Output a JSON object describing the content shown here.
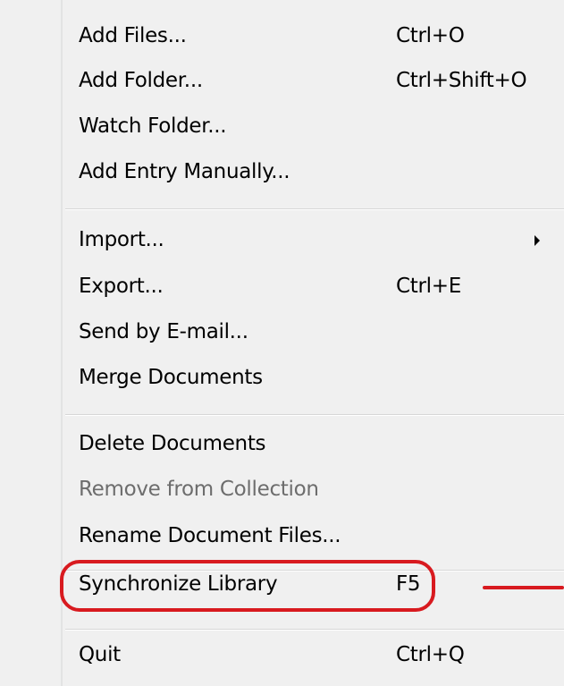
{
  "menu": {
    "items": [
      {
        "label": "Add Files...",
        "shortcut": "Ctrl+O"
      },
      {
        "label": "Add Folder...",
        "shortcut": "Ctrl+Shift+O"
      },
      {
        "label": "Watch Folder...",
        "shortcut": ""
      },
      {
        "label": "Add Entry Manually...",
        "shortcut": ""
      },
      {
        "label": "Import...",
        "shortcut": ""
      },
      {
        "label": "Export...",
        "shortcut": "Ctrl+E"
      },
      {
        "label": "Send by E-mail...",
        "shortcut": ""
      },
      {
        "label": "Merge Documents",
        "shortcut": ""
      },
      {
        "label": "Delete Documents",
        "shortcut": ""
      },
      {
        "label": "Remove from Collection",
        "shortcut": "",
        "disabled": true
      },
      {
        "label": "Rename Document Files...",
        "shortcut": ""
      },
      {
        "label": "Synchronize Library",
        "shortcut": "F5"
      },
      {
        "label": "Quit",
        "shortcut": "Ctrl+Q"
      }
    ]
  },
  "annotation": {
    "color": "#d81a1f",
    "highlighted_item": "Synchronize Library"
  },
  "icons": {
    "submenu": "chevron-right-icon"
  }
}
